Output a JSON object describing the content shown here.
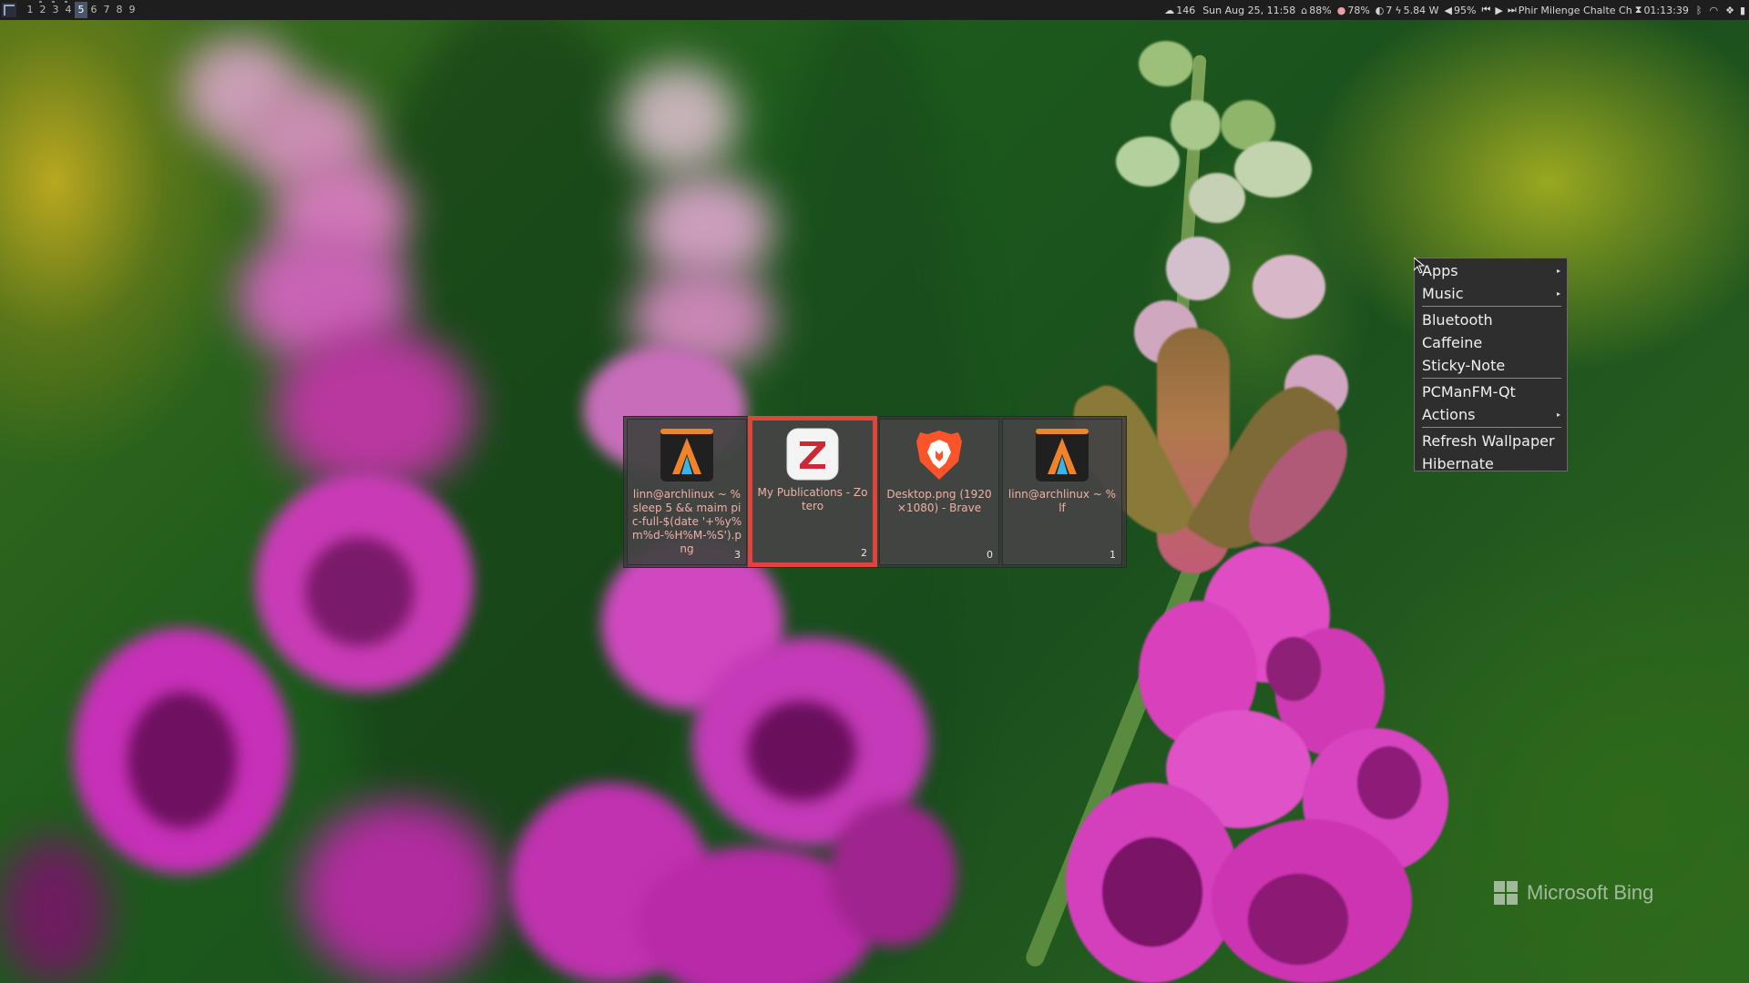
{
  "topbar": {
    "workspaces": [
      "1",
      "2",
      "3",
      "4",
      "5",
      "6",
      "7",
      "8",
      "9"
    ],
    "active_workspace_index": 4,
    "status": {
      "updates": "146",
      "datetime": "Sun Aug 25, 11:58",
      "home_disk": "88%",
      "memory": "78%",
      "brightness": "7",
      "power": "5.84 W",
      "volume": "95%",
      "media_title": "Phir Milenge Chalte Ch",
      "media_time": "01:13:39"
    },
    "icons": {
      "updates": "cloud-icon",
      "home": "home-icon",
      "memory": "brain-icon",
      "brightness": "brightness-icon",
      "power": "bolt-icon",
      "volume": "volume-icon",
      "prev": "prev-track-icon",
      "play": "play-icon",
      "next": "next-track-icon",
      "bluetooth": "bluetooth-icon",
      "wifi": "wifi-icon",
      "tray": "dropbox-icon",
      "battery": "battery-icon"
    }
  },
  "switcher": {
    "windows": [
      {
        "title": "linn@archlinux ~ % sleep 5 && maim pic-full-$(date '+%y%m%d-%H%M-%S').png",
        "number": "3",
        "icon": "alacritty-icon",
        "selected": false
      },
      {
        "title": "My Publications - Zotero",
        "number": "2",
        "icon": "zotero-icon",
        "selected": true
      },
      {
        "title": "Desktop.png (1920×1080) - Brave",
        "number": "0",
        "icon": "brave-icon",
        "selected": false
      },
      {
        "title": "linn@archlinux ~ % lf",
        "number": "1",
        "icon": "alacritty-icon",
        "selected": false
      }
    ]
  },
  "menu": {
    "items": [
      {
        "label": "Apps",
        "submenu": true
      },
      {
        "label": "Music",
        "submenu": true
      },
      {
        "label": "Bluetooth",
        "submenu": false
      },
      {
        "label": "Caffeine",
        "submenu": false
      },
      {
        "label": "Sticky-Note",
        "submenu": false
      },
      {
        "label": "PCManFM-Qt",
        "submenu": false
      },
      {
        "label": "Actions",
        "submenu": true
      },
      {
        "label": "Refresh Wallpaper",
        "submenu": false
      },
      {
        "label": "Hibernate",
        "submenu": false
      }
    ],
    "submenu_arrow": "▸"
  },
  "wallpaper": {
    "watermark": "Microsoft Bing"
  },
  "colors": {
    "selected_border": "#e0443b",
    "bar_bg": "#1e1e1e",
    "menu_bg": "#2e2e2e"
  }
}
